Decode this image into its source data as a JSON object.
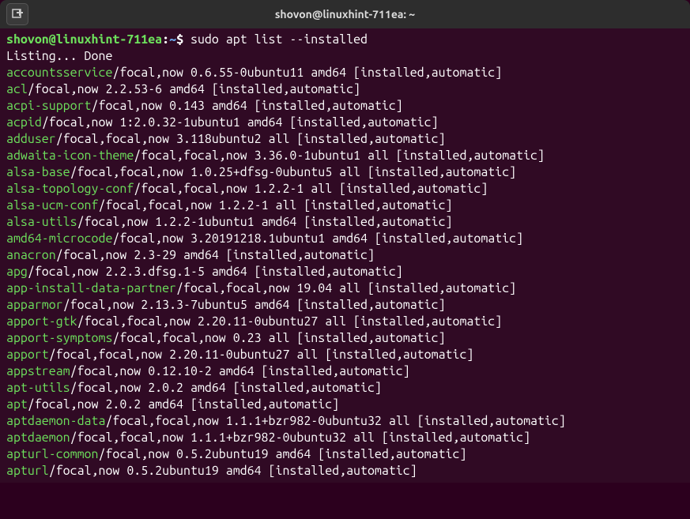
{
  "titlebar": {
    "title": "shovon@linuxhint-711ea: ~"
  },
  "prompt": {
    "user": "shovon@linuxhint-711ea",
    "colon": ":",
    "path": "~",
    "symbol": "$"
  },
  "command": " sudo apt list --installed",
  "listing_line": "Listing... Done",
  "packages": [
    {
      "name": "accountsservice",
      "rest": "/focal,now 0.6.55-0ubuntu11 amd64 [installed,automatic]"
    },
    {
      "name": "acl",
      "rest": "/focal,now 2.2.53-6 amd64 [installed,automatic]"
    },
    {
      "name": "acpi-support",
      "rest": "/focal,now 0.143 amd64 [installed,automatic]"
    },
    {
      "name": "acpid",
      "rest": "/focal,now 1:2.0.32-1ubuntu1 amd64 [installed,automatic]"
    },
    {
      "name": "adduser",
      "rest": "/focal,focal,now 3.118ubuntu2 all [installed,automatic]"
    },
    {
      "name": "adwaita-icon-theme",
      "rest": "/focal,focal,now 3.36.0-1ubuntu1 all [installed,automatic]"
    },
    {
      "name": "alsa-base",
      "rest": "/focal,focal,now 1.0.25+dfsg-0ubuntu5 all [installed,automatic]"
    },
    {
      "name": "alsa-topology-conf",
      "rest": "/focal,focal,now 1.2.2-1 all [installed,automatic]"
    },
    {
      "name": "alsa-ucm-conf",
      "rest": "/focal,focal,now 1.2.2-1 all [installed,automatic]"
    },
    {
      "name": "alsa-utils",
      "rest": "/focal,now 1.2.2-1ubuntu1 amd64 [installed,automatic]"
    },
    {
      "name": "amd64-microcode",
      "rest": "/focal,now 3.20191218.1ubuntu1 amd64 [installed,automatic]"
    },
    {
      "name": "anacron",
      "rest": "/focal,now 2.3-29 amd64 [installed,automatic]"
    },
    {
      "name": "apg",
      "rest": "/focal,now 2.2.3.dfsg.1-5 amd64 [installed,automatic]"
    },
    {
      "name": "app-install-data-partner",
      "rest": "/focal,focal,now 19.04 all [installed,automatic]"
    },
    {
      "name": "apparmor",
      "rest": "/focal,now 2.13.3-7ubuntu5 amd64 [installed,automatic]"
    },
    {
      "name": "apport-gtk",
      "rest": "/focal,focal,now 2.20.11-0ubuntu27 all [installed,automatic]"
    },
    {
      "name": "apport-symptoms",
      "rest": "/focal,focal,now 0.23 all [installed,automatic]"
    },
    {
      "name": "apport",
      "rest": "/focal,focal,now 2.20.11-0ubuntu27 all [installed,automatic]"
    },
    {
      "name": "appstream",
      "rest": "/focal,now 0.12.10-2 amd64 [installed,automatic]"
    },
    {
      "name": "apt-utils",
      "rest": "/focal,now 2.0.2 amd64 [installed,automatic]"
    },
    {
      "name": "apt",
      "rest": "/focal,now 2.0.2 amd64 [installed,automatic]"
    },
    {
      "name": "aptdaemon-data",
      "rest": "/focal,focal,now 1.1.1+bzr982-0ubuntu32 all [installed,automatic]"
    },
    {
      "name": "aptdaemon",
      "rest": "/focal,focal,now 1.1.1+bzr982-0ubuntu32 all [installed,automatic]"
    },
    {
      "name": "apturl-common",
      "rest": "/focal,now 0.5.2ubuntu19 amd64 [installed,automatic]"
    },
    {
      "name": "apturl",
      "rest": "/focal,now 0.5.2ubuntu19 amd64 [installed,automatic]"
    }
  ]
}
